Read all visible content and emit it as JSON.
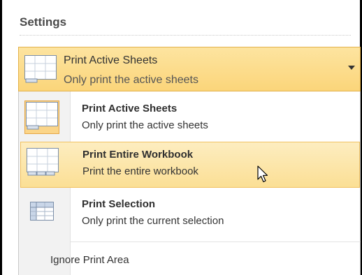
{
  "settings": {
    "heading": "Settings"
  },
  "selector": {
    "title": "Print Active Sheets",
    "subtitle": "Only print the active sheets",
    "dropdown_icon": "chevron-down-icon"
  },
  "menu": {
    "items": [
      {
        "name": "Print Active Sheets",
        "description": "Only print the active sheets",
        "icon": "sheet-grid-icon",
        "selected": true
      },
      {
        "name": "Print Entire Workbook",
        "description": "Print the entire workbook",
        "icon": "workbook-grid-icon",
        "hovered": true
      },
      {
        "name": "Print Selection",
        "description": "Only print the current selection",
        "icon": "selection-grid-icon"
      }
    ],
    "ignore_print_area": "Ignore Print Area"
  },
  "colors": {
    "accent_fill": "#fbd57a",
    "accent_border": "#e2b14a",
    "hover_fill": "#fbdf95",
    "text": "#333333"
  }
}
